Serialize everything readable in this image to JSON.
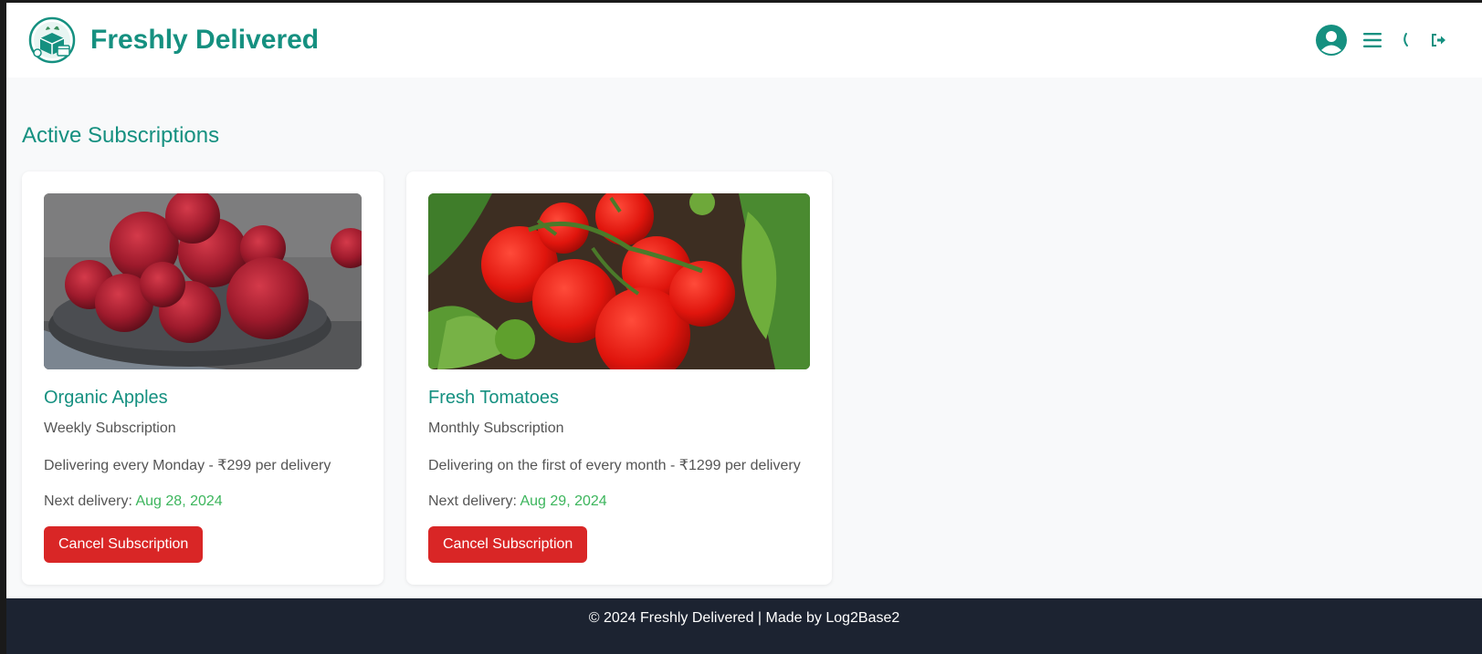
{
  "header": {
    "brand_title": "Freshly Delivered",
    "icons": [
      "user-icon",
      "menu-icon",
      "moon-icon",
      "logout-icon"
    ],
    "accent_color": "#159080"
  },
  "main": {
    "section_title": "Active Subscriptions",
    "subscriptions": [
      {
        "title": "Organic Apples",
        "plan": "Weekly Subscription",
        "description": "Delivering every Monday - ₹299 per delivery",
        "next_label": "Next delivery: ",
        "next_date": "Aug 28, 2024",
        "cancel_label": "Cancel Subscription",
        "image": "bowl-of-red-apples"
      },
      {
        "title": "Fresh Tomatoes",
        "plan": "Monthly Subscription",
        "description": "Delivering on the first of every month - ₹1299 per delivery",
        "next_label": "Next delivery: ",
        "next_date": "Aug 29, 2024",
        "cancel_label": "Cancel Subscription",
        "image": "tomatoes-on-vine"
      }
    ]
  },
  "footer": {
    "text": "© 2024 Freshly Delivered | Made by Log2Base2"
  },
  "colors": {
    "accent": "#159080",
    "date_green": "#3cb55c",
    "danger": "#d92626",
    "footer_bg": "#1c2331"
  }
}
